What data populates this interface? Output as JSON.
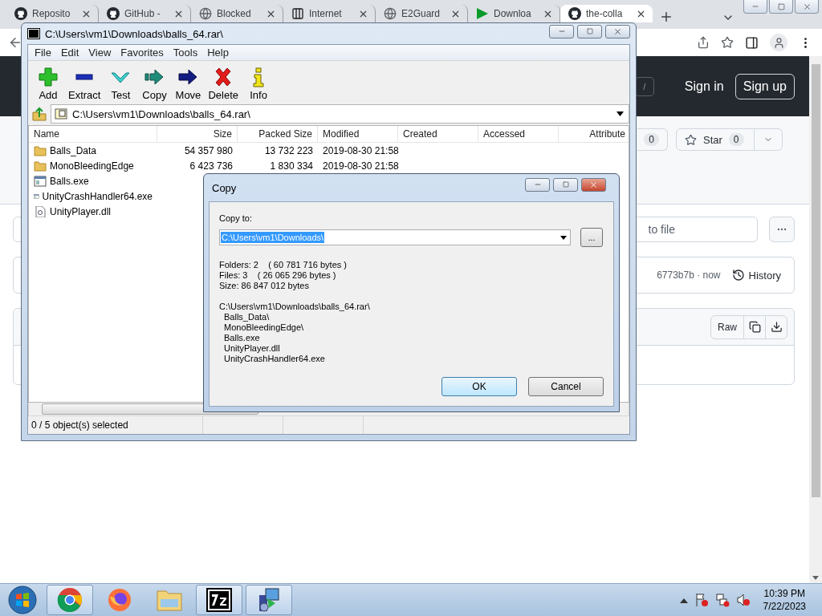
{
  "browser": {
    "tabs": [
      {
        "title": "Reposito",
        "kind": "github",
        "selected": false
      },
      {
        "title": "GitHub -",
        "kind": "github",
        "selected": false
      },
      {
        "title": "Blocked",
        "kind": "globe",
        "selected": false
      },
      {
        "title": "Internet",
        "kind": "columns",
        "selected": false
      },
      {
        "title": "E2Guard",
        "kind": "globe",
        "selected": false
      },
      {
        "title": "Downloa",
        "kind": "play",
        "selected": false
      },
      {
        "title": "the-colla",
        "kind": "github",
        "selected": true
      }
    ],
    "header": {
      "search_key": "/",
      "sign_in": "Sign in",
      "sign_up": "Sign up"
    },
    "repo_actions": {
      "fork_count": "0",
      "star_label": "Star",
      "star_count": "0"
    },
    "file_search": {
      "placeholder": "to file"
    },
    "commit": {
      "sha_time": "6773b7b · now",
      "history": "History"
    },
    "file_actions": {
      "raw": "Raw"
    }
  },
  "archive_window": {
    "title": "C:\\Users\\vm1\\Downloads\\balls_64.rar\\",
    "menu": [
      "File",
      "Edit",
      "View",
      "Favorites",
      "Tools",
      "Help"
    ],
    "toolbar": [
      {
        "label": "Add",
        "kind": "add"
      },
      {
        "label": "Extract",
        "kind": "extract"
      },
      {
        "label": "Test",
        "kind": "test"
      },
      {
        "label": "Copy",
        "kind": "copy"
      },
      {
        "label": "Move",
        "kind": "move"
      },
      {
        "label": "Delete",
        "kind": "delete"
      },
      {
        "label": "Info",
        "kind": "info"
      }
    ],
    "path": "C:\\Users\\vm1\\Downloads\\balls_64.rar\\",
    "columns": [
      "Name",
      "Size",
      "Packed Size",
      "Modified",
      "Created",
      "Accessed",
      "Attribute"
    ],
    "rows": [
      {
        "kind": "folder",
        "name": "Balls_Data",
        "size": "54 357 980",
        "packed": "13 732 223",
        "modified": "2019-08-30 21:58"
      },
      {
        "kind": "folder",
        "name": "MonoBleedingEdge",
        "size": "6 423 736",
        "packed": "1 830 334",
        "modified": "2019-08-30 21:58"
      },
      {
        "kind": "exe",
        "name": "Balls.exe"
      },
      {
        "kind": "exe",
        "name": "UnityCrashHandler64.exe"
      },
      {
        "kind": "dll",
        "name": "UnityPlayer.dll"
      }
    ],
    "status": "0 / 5 object(s) selected"
  },
  "copy_dialog": {
    "title": "Copy",
    "label": "Copy to:",
    "value": "C:\\Users\\vm1\\Downloads\\",
    "browse": "...",
    "summary": [
      "Folders: 2    ( 60 781 716 bytes )",
      "Files: 3    ( 26 065 296 bytes )",
      "Size: 86 847 012 bytes"
    ],
    "source": "C:\\Users\\vm1\\Downloads\\balls_64.rar\\",
    "items": [
      "Balls_Data\\",
      "MonoBleedingEdge\\",
      "Balls.exe",
      "UnityPlayer.dll",
      "UnityCrashHandler64.exe"
    ],
    "ok": "OK",
    "cancel": "Cancel"
  },
  "taskbar": {
    "apps": [
      {
        "kind": "chrome",
        "running": true
      },
      {
        "kind": "firefox",
        "running": false
      },
      {
        "kind": "explorer",
        "running": false
      },
      {
        "kind": "sevenzip",
        "running": true
      },
      {
        "kind": "installer",
        "running": true
      }
    ],
    "clock": {
      "time": "10:39 PM",
      "date": "7/22/2023"
    }
  }
}
